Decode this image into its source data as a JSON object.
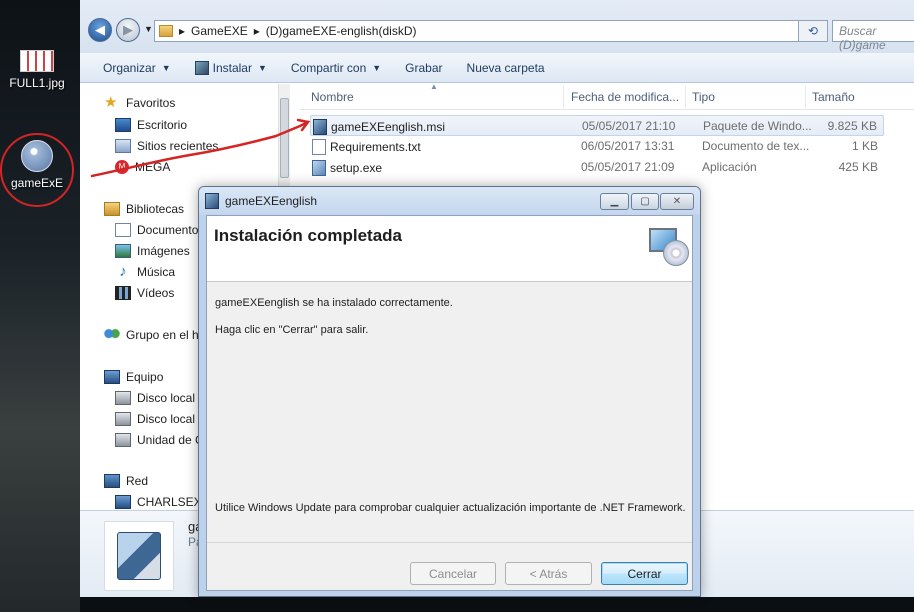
{
  "desktop": {
    "icons": [
      {
        "label": "FULL1.jpg"
      },
      {
        "label": "gameExE"
      }
    ]
  },
  "explorer": {
    "address": {
      "crumbs": [
        "GameEXE",
        "(D)gameEXE-english(diskD)"
      ],
      "search_placeholder": "Buscar (D)game"
    },
    "toolbar": {
      "organize": "Organizar",
      "install": "Instalar",
      "share": "Compartir con",
      "burn": "Grabar",
      "new_folder": "Nueva carpeta"
    },
    "nav": {
      "favorites": "Favoritos",
      "desktop": "Escritorio",
      "recent": "Sitios recientes",
      "mega": "MEGA",
      "libraries": "Bibliotecas",
      "documents": "Documento",
      "images": "Imágenes",
      "music": "Música",
      "videos": "Vídeos",
      "homegroup": "Grupo en el h",
      "computer": "Equipo",
      "disk1": "Disco local (",
      "disk2": "Disco local (",
      "drive": "Unidad de C",
      "network": "Red",
      "network_pc": "CHARLSEXE"
    },
    "columns": {
      "name": "Nombre",
      "date": "Fecha de modifica...",
      "type": "Tipo",
      "size": "Tamaño"
    },
    "files": [
      {
        "name": "gameEXEenglish.msi",
        "date": "05/05/2017 21:10",
        "type": "Paquete de Windo...",
        "size": "9.825 KB"
      },
      {
        "name": "Requirements.txt",
        "date": "06/05/2017 13:31",
        "type": "Documento de tex...",
        "size": "1 KB"
      },
      {
        "name": "setup.exe",
        "date": "05/05/2017 21:09",
        "type": "Aplicación",
        "size": "425 KB"
      }
    ],
    "details": {
      "name": "ga",
      "sub": "Pa"
    }
  },
  "dialog": {
    "title": "gameEXEenglish",
    "heading": "Instalación completada",
    "success": "gameEXEenglish se ha instalado correctamente.",
    "close_hint": "Haga clic en \"Cerrar\" para salir.",
    "netfx": "Utilice Windows Update para comprobar cualquier actualización importante de .NET Framework.",
    "buttons": {
      "cancel": "Cancelar",
      "back": "< Atrás",
      "finish": "Cerrar"
    }
  },
  "colors": {
    "annotation": "#d42424",
    "accent": "#3c7fb1"
  }
}
